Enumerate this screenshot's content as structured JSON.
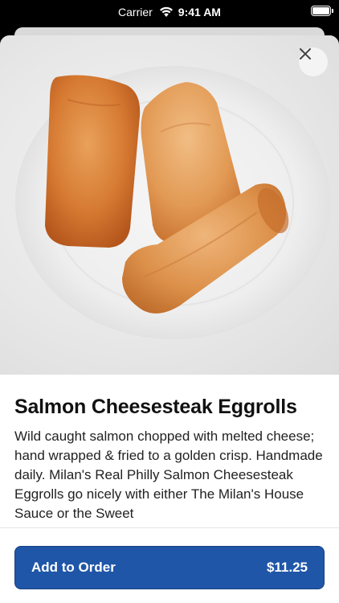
{
  "status_bar": {
    "carrier": "Carrier",
    "time": "9:41 AM"
  },
  "item": {
    "title": "Salmon Cheesesteak Eggrolls",
    "description": "Wild caught salmon chopped with melted cheese; hand wrapped & fried to a golden crisp. Handmade daily. Milan's Real Philly Salmon Cheesesteak Eggrolls go nicely with either The Milan's House Sauce or the Sweet",
    "image_alt": "eggrolls-photo"
  },
  "order_button": {
    "label": "Add to Order",
    "price": "$11.25"
  },
  "colors": {
    "primary": "#1f56a8",
    "title_text": "#111111"
  },
  "icons": {
    "close": "close-icon",
    "wifi": "wifi-icon",
    "battery": "battery-icon"
  }
}
